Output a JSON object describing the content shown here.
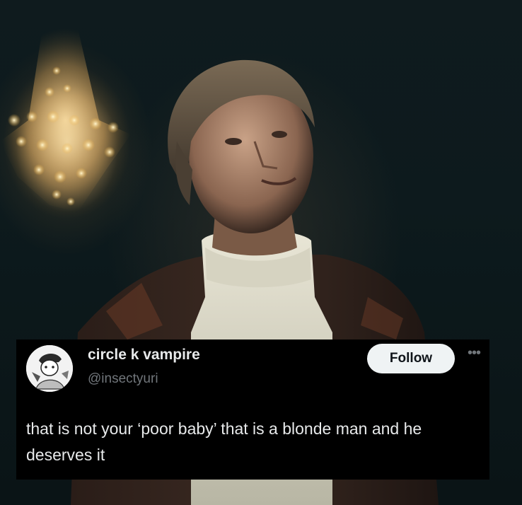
{
  "tweet": {
    "display_name": "circle k vampire",
    "handle": "@insectyuri",
    "follow_label": "Follow",
    "more_icon": "more-horizontal-icon",
    "text": "that is not your ‘poor baby’ that is a blonde man and he deserves it"
  },
  "colors": {
    "card_background": "#000000",
    "primary_text": "#e7e9ea",
    "secondary_text": "#71767b",
    "follow_button_bg": "#eff3f4",
    "follow_button_text": "#0f1419"
  }
}
